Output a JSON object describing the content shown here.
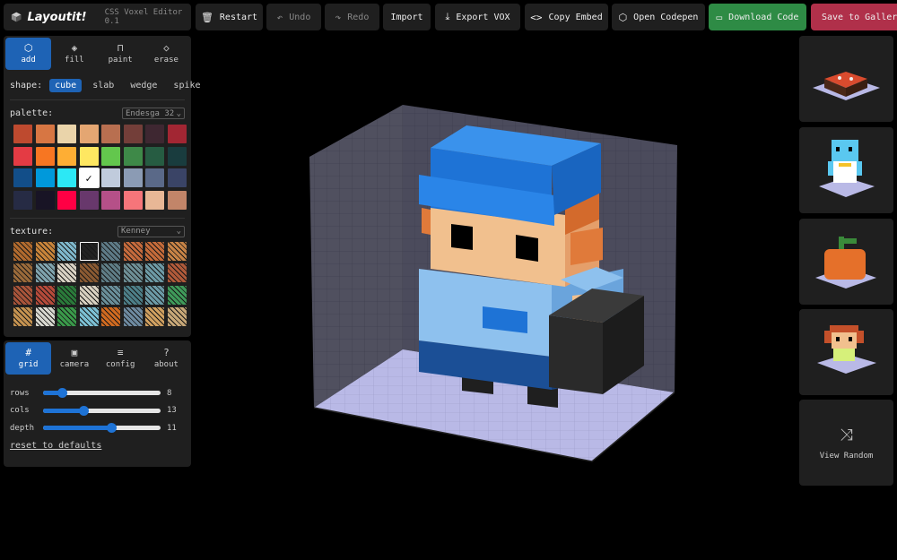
{
  "app": {
    "title": "Layoutit!",
    "subtitle": "CSS Voxel Editor 0.1"
  },
  "toolbar": {
    "restart": "Restart",
    "undo": "Undo",
    "redo": "Redo",
    "import": "Import",
    "export_vox": "Export VOX",
    "copy_embed": "Copy Embed",
    "open_codepen": "Open Codepen",
    "download_code": "Download Code",
    "save_gallery": "Save to Gallery"
  },
  "icons": {
    "restart": "trash-icon",
    "undo": "undo-icon",
    "redo": "redo-icon",
    "export": "download-icon",
    "embed": "code-icon",
    "codepen": "codepen-icon",
    "download": "folder-icon"
  },
  "tools": {
    "tabs": [
      {
        "label": "add",
        "icon": "cube-icon",
        "active": true
      },
      {
        "label": "fill",
        "icon": "bucket-icon",
        "active": false
      },
      {
        "label": "paint",
        "icon": "brush-icon",
        "active": false
      },
      {
        "label": "erase",
        "icon": "eraser-icon",
        "active": false
      }
    ],
    "shape_label": "shape:",
    "shapes": [
      {
        "label": "cube",
        "active": true
      },
      {
        "label": "slab",
        "active": false
      },
      {
        "label": "wedge",
        "active": false
      },
      {
        "label": "spike",
        "active": false
      }
    ],
    "palette_label": "palette:",
    "palette_name": "Endesga 32",
    "palette": [
      "#be4a2f",
      "#d77643",
      "#ead4aa",
      "#e4a672",
      "#b86f50",
      "#733e39",
      "#3e2731",
      "#a22633",
      "#e43b44",
      "#f77622",
      "#feae34",
      "#fee761",
      "#63c74d",
      "#3e8948",
      "#265c42",
      "#193c3e",
      "#124e89",
      "#0099db",
      "#2ce8f5",
      "#ffffff",
      "#c0cbdc",
      "#8b9bb4",
      "#5a6988",
      "#3a4466",
      "#262b44",
      "#181425",
      "#ff0044",
      "#68386c",
      "#b55088",
      "#f6757a",
      "#e8b796",
      "#c28569"
    ],
    "selected_swatch": 19,
    "texture_label": "texture:",
    "texture_name": "Kenney",
    "textures": [
      "#b06a2e",
      "#c8843a",
      "#7fb8cc",
      "#222222",
      "#5e7a86",
      "#c56a3c",
      "#c46b3a",
      "#c78346",
      "#9a6a3a",
      "#7fa3ad",
      "#d9d2c4",
      "#8a5a32",
      "#5f7d86",
      "#6e8f96",
      "#6d9aa5",
      "#b05a3a",
      "#a8543a",
      "#b64a3a",
      "#2a7a3a",
      "#d8d0c0",
      "#6a8f9a",
      "#4d7f88",
      "#6c9aa6",
      "#3f9a5a",
      "#c49250",
      "#d8d8d0",
      "#3a9a4a",
      "#7cc0d4",
      "#d06a20",
      "#6e8aa0",
      "#d0a060",
      "#c8a878"
    ],
    "selected_texture": 3
  },
  "grid": {
    "tabs": [
      {
        "label": "grid",
        "icon": "grid-icon",
        "active": true
      },
      {
        "label": "camera",
        "icon": "camera-icon",
        "active": false
      },
      {
        "label": "config",
        "icon": "sliders-icon",
        "active": false
      },
      {
        "label": "about",
        "icon": "help-icon",
        "active": false
      }
    ],
    "sliders": [
      {
        "name": "rows",
        "value": 8,
        "fraction": 0.16
      },
      {
        "name": "cols",
        "value": 13,
        "fraction": 0.34
      },
      {
        "name": "depth",
        "value": 11,
        "fraction": 0.58
      }
    ],
    "reset": "reset to defaults"
  },
  "gallery": {
    "items": [
      {
        "name": "gallery-item-cake"
      },
      {
        "name": "gallery-item-penguin"
      },
      {
        "name": "gallery-item-pumpkin"
      },
      {
        "name": "gallery-item-girl"
      }
    ],
    "view_random": "View Random",
    "view_random_icon": "shuffle-icon"
  },
  "colors": {
    "accent": "#1e63b5",
    "green": "#2e8b45",
    "red": "#b0304a",
    "panel": "#1f1f1f"
  }
}
